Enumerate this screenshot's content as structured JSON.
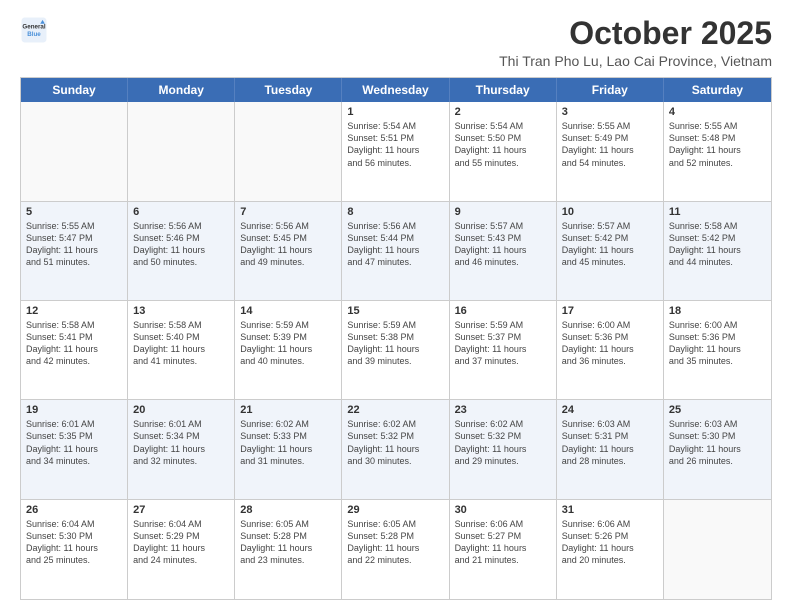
{
  "logo": {
    "line1": "General",
    "line2": "Blue"
  },
  "title": "October 2025",
  "location": "Thi Tran Pho Lu, Lao Cai Province, Vietnam",
  "days_of_week": [
    "Sunday",
    "Monday",
    "Tuesday",
    "Wednesday",
    "Thursday",
    "Friday",
    "Saturday"
  ],
  "weeks": [
    [
      {
        "day": "",
        "lines": [],
        "empty": true
      },
      {
        "day": "",
        "lines": [],
        "empty": true
      },
      {
        "day": "",
        "lines": [],
        "empty": true
      },
      {
        "day": "1",
        "lines": [
          "Sunrise: 5:54 AM",
          "Sunset: 5:51 PM",
          "Daylight: 11 hours",
          "and 56 minutes."
        ],
        "empty": false
      },
      {
        "day": "2",
        "lines": [
          "Sunrise: 5:54 AM",
          "Sunset: 5:50 PM",
          "Daylight: 11 hours",
          "and 55 minutes."
        ],
        "empty": false
      },
      {
        "day": "3",
        "lines": [
          "Sunrise: 5:55 AM",
          "Sunset: 5:49 PM",
          "Daylight: 11 hours",
          "and 54 minutes."
        ],
        "empty": false
      },
      {
        "day": "4",
        "lines": [
          "Sunrise: 5:55 AM",
          "Sunset: 5:48 PM",
          "Daylight: 11 hours",
          "and 52 minutes."
        ],
        "empty": false
      }
    ],
    [
      {
        "day": "5",
        "lines": [
          "Sunrise: 5:55 AM",
          "Sunset: 5:47 PM",
          "Daylight: 11 hours",
          "and 51 minutes."
        ],
        "empty": false
      },
      {
        "day": "6",
        "lines": [
          "Sunrise: 5:56 AM",
          "Sunset: 5:46 PM",
          "Daylight: 11 hours",
          "and 50 minutes."
        ],
        "empty": false
      },
      {
        "day": "7",
        "lines": [
          "Sunrise: 5:56 AM",
          "Sunset: 5:45 PM",
          "Daylight: 11 hours",
          "and 49 minutes."
        ],
        "empty": false
      },
      {
        "day": "8",
        "lines": [
          "Sunrise: 5:56 AM",
          "Sunset: 5:44 PM",
          "Daylight: 11 hours",
          "and 47 minutes."
        ],
        "empty": false
      },
      {
        "day": "9",
        "lines": [
          "Sunrise: 5:57 AM",
          "Sunset: 5:43 PM",
          "Daylight: 11 hours",
          "and 46 minutes."
        ],
        "empty": false
      },
      {
        "day": "10",
        "lines": [
          "Sunrise: 5:57 AM",
          "Sunset: 5:42 PM",
          "Daylight: 11 hours",
          "and 45 minutes."
        ],
        "empty": false
      },
      {
        "day": "11",
        "lines": [
          "Sunrise: 5:58 AM",
          "Sunset: 5:42 PM",
          "Daylight: 11 hours",
          "and 44 minutes."
        ],
        "empty": false
      }
    ],
    [
      {
        "day": "12",
        "lines": [
          "Sunrise: 5:58 AM",
          "Sunset: 5:41 PM",
          "Daylight: 11 hours",
          "and 42 minutes."
        ],
        "empty": false
      },
      {
        "day": "13",
        "lines": [
          "Sunrise: 5:58 AM",
          "Sunset: 5:40 PM",
          "Daylight: 11 hours",
          "and 41 minutes."
        ],
        "empty": false
      },
      {
        "day": "14",
        "lines": [
          "Sunrise: 5:59 AM",
          "Sunset: 5:39 PM",
          "Daylight: 11 hours",
          "and 40 minutes."
        ],
        "empty": false
      },
      {
        "day": "15",
        "lines": [
          "Sunrise: 5:59 AM",
          "Sunset: 5:38 PM",
          "Daylight: 11 hours",
          "and 39 minutes."
        ],
        "empty": false
      },
      {
        "day": "16",
        "lines": [
          "Sunrise: 5:59 AM",
          "Sunset: 5:37 PM",
          "Daylight: 11 hours",
          "and 37 minutes."
        ],
        "empty": false
      },
      {
        "day": "17",
        "lines": [
          "Sunrise: 6:00 AM",
          "Sunset: 5:36 PM",
          "Daylight: 11 hours",
          "and 36 minutes."
        ],
        "empty": false
      },
      {
        "day": "18",
        "lines": [
          "Sunrise: 6:00 AM",
          "Sunset: 5:36 PM",
          "Daylight: 11 hours",
          "and 35 minutes."
        ],
        "empty": false
      }
    ],
    [
      {
        "day": "19",
        "lines": [
          "Sunrise: 6:01 AM",
          "Sunset: 5:35 PM",
          "Daylight: 11 hours",
          "and 34 minutes."
        ],
        "empty": false
      },
      {
        "day": "20",
        "lines": [
          "Sunrise: 6:01 AM",
          "Sunset: 5:34 PM",
          "Daylight: 11 hours",
          "and 32 minutes."
        ],
        "empty": false
      },
      {
        "day": "21",
        "lines": [
          "Sunrise: 6:02 AM",
          "Sunset: 5:33 PM",
          "Daylight: 11 hours",
          "and 31 minutes."
        ],
        "empty": false
      },
      {
        "day": "22",
        "lines": [
          "Sunrise: 6:02 AM",
          "Sunset: 5:32 PM",
          "Daylight: 11 hours",
          "and 30 minutes."
        ],
        "empty": false
      },
      {
        "day": "23",
        "lines": [
          "Sunrise: 6:02 AM",
          "Sunset: 5:32 PM",
          "Daylight: 11 hours",
          "and 29 minutes."
        ],
        "empty": false
      },
      {
        "day": "24",
        "lines": [
          "Sunrise: 6:03 AM",
          "Sunset: 5:31 PM",
          "Daylight: 11 hours",
          "and 28 minutes."
        ],
        "empty": false
      },
      {
        "day": "25",
        "lines": [
          "Sunrise: 6:03 AM",
          "Sunset: 5:30 PM",
          "Daylight: 11 hours",
          "and 26 minutes."
        ],
        "empty": false
      }
    ],
    [
      {
        "day": "26",
        "lines": [
          "Sunrise: 6:04 AM",
          "Sunset: 5:30 PM",
          "Daylight: 11 hours",
          "and 25 minutes."
        ],
        "empty": false
      },
      {
        "day": "27",
        "lines": [
          "Sunrise: 6:04 AM",
          "Sunset: 5:29 PM",
          "Daylight: 11 hours",
          "and 24 minutes."
        ],
        "empty": false
      },
      {
        "day": "28",
        "lines": [
          "Sunrise: 6:05 AM",
          "Sunset: 5:28 PM",
          "Daylight: 11 hours",
          "and 23 minutes."
        ],
        "empty": false
      },
      {
        "day": "29",
        "lines": [
          "Sunrise: 6:05 AM",
          "Sunset: 5:28 PM",
          "Daylight: 11 hours",
          "and 22 minutes."
        ],
        "empty": false
      },
      {
        "day": "30",
        "lines": [
          "Sunrise: 6:06 AM",
          "Sunset: 5:27 PM",
          "Daylight: 11 hours",
          "and 21 minutes."
        ],
        "empty": false
      },
      {
        "day": "31",
        "lines": [
          "Sunrise: 6:06 AM",
          "Sunset: 5:26 PM",
          "Daylight: 11 hours",
          "and 20 minutes."
        ],
        "empty": false
      },
      {
        "day": "",
        "lines": [],
        "empty": true
      }
    ]
  ]
}
